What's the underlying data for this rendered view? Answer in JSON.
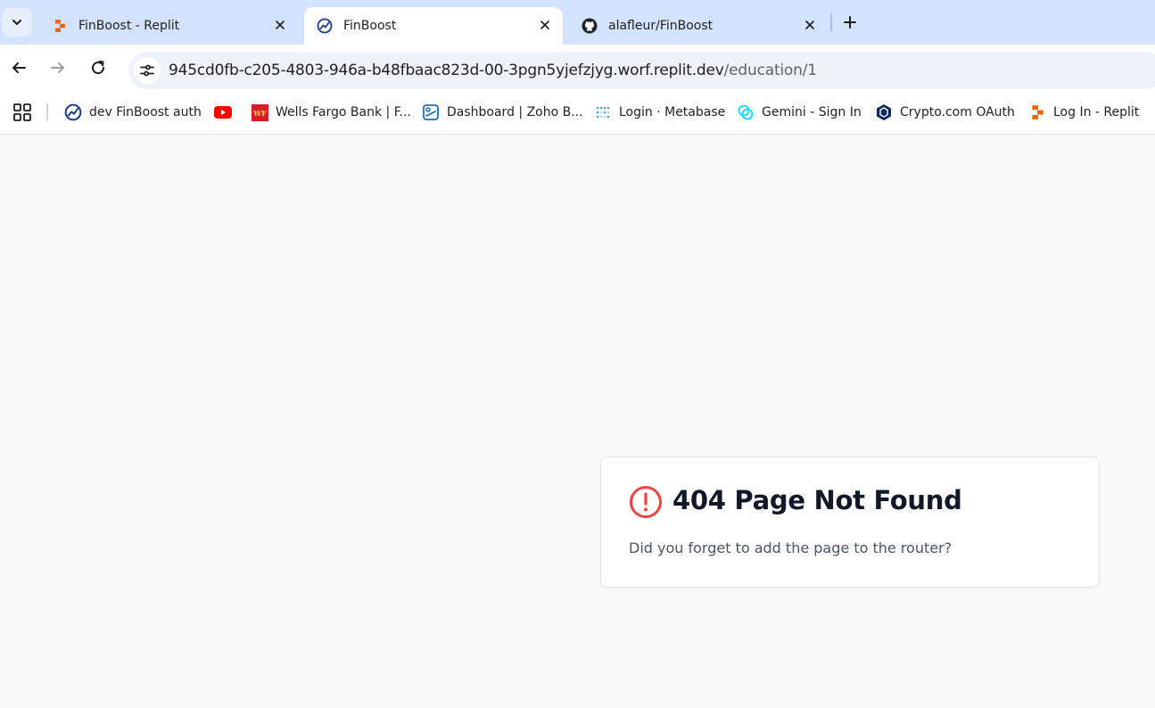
{
  "tabs": [
    {
      "title": "FinBoost - Replit",
      "icon": "replit-icon",
      "active": false
    },
    {
      "title": "FinBoost",
      "icon": "finboost-icon",
      "active": true
    },
    {
      "title": "alafleur/FinBoost",
      "icon": "github-icon",
      "active": false
    }
  ],
  "address_bar": {
    "host": "945cd0fb-c205-4803-946a-b48fbaac823d-00-3pgn5yjefzjyg.worf.replit.dev",
    "path": "/education/1"
  },
  "bookmarks": [
    {
      "label": "dev FinBoost auth",
      "icon": "finboost-icon"
    },
    {
      "label": "",
      "icon": "youtube-icon"
    },
    {
      "label": "Wells Fargo Bank | F...",
      "icon": "wells-fargo-icon"
    },
    {
      "label": "Dashboard | Zoho B...",
      "icon": "zoho-icon"
    },
    {
      "label": "Login · Metabase",
      "icon": "metabase-icon"
    },
    {
      "label": "Gemini - Sign In",
      "icon": "gemini-icon"
    },
    {
      "label": "Crypto.com OAuth",
      "icon": "crypto-com-icon"
    },
    {
      "label": "Log In - Replit",
      "icon": "replit-icon"
    }
  ],
  "page": {
    "heading": "404 Page Not Found",
    "message": "Did you forget to add the page to the router?",
    "icon": "alert-circle-icon"
  },
  "colors": {
    "tabstrip": "#d3e3fd",
    "page_background": "#f8f9fb",
    "alert": "#ef4444",
    "heading": "#111827"
  }
}
